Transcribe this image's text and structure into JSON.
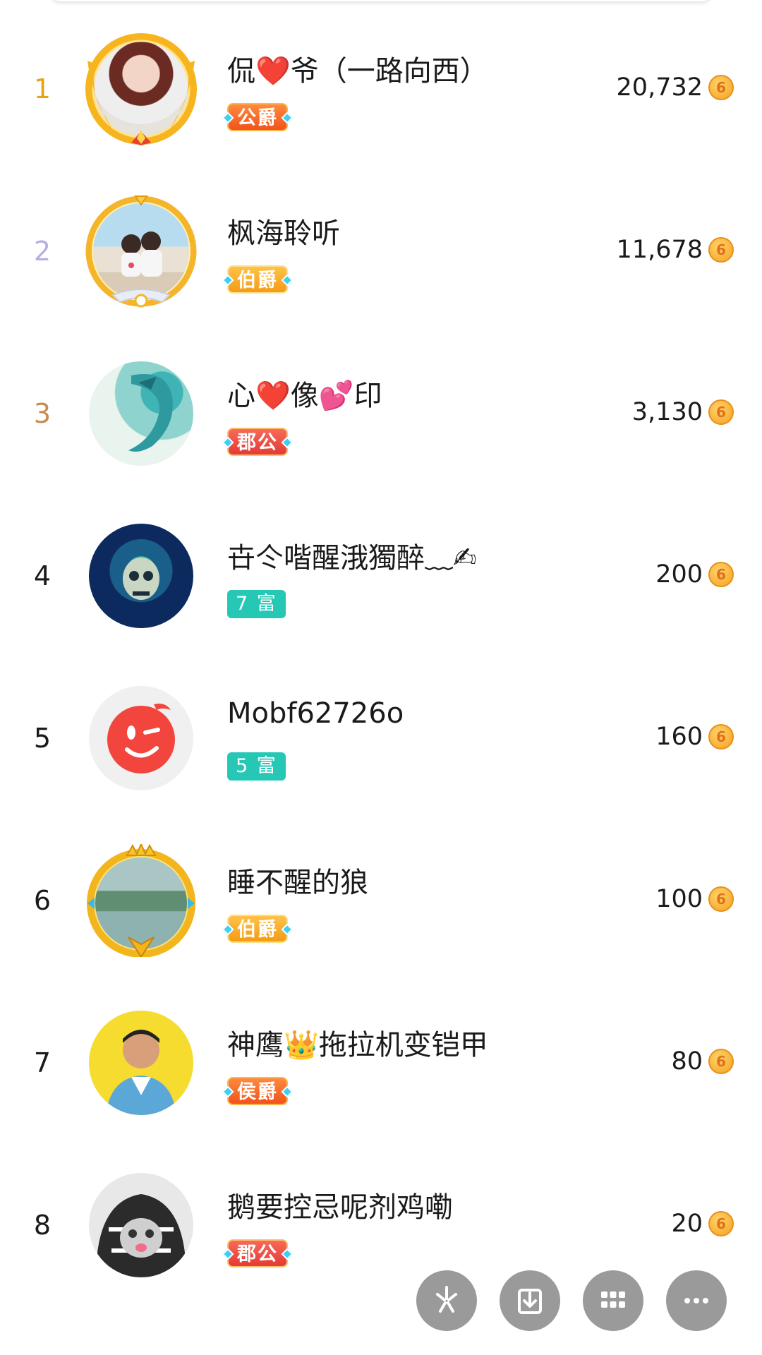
{
  "list": {
    "rows": [
      {
        "rank": "1",
        "name": "侃❤️爷（一路向西）",
        "badge": "公爵",
        "score": "20,732"
      },
      {
        "rank": "2",
        "name": "枫海聆听",
        "badge": "伯爵",
        "score": "11,678"
      },
      {
        "rank": "3",
        "name": "心❤️像💕印",
        "badge": "郡公",
        "score": "3,130"
      },
      {
        "rank": "4",
        "name": "卋仒喈醒涐獨醉﹏✍",
        "badge": "7 富",
        "score": "200"
      },
      {
        "rank": "5",
        "name": "Mobf62726o",
        "badge": "5 富",
        "score": "160"
      },
      {
        "rank": "6",
        "name": "睡不醒的狼",
        "badge": "伯爵",
        "score": "100"
      },
      {
        "rank": "7",
        "name": "神鹰👑拖拉机变铠甲",
        "badge": "侯爵",
        "score": "80"
      },
      {
        "rank": "8",
        "name": "鹅要控忌呢剂鸡嘞",
        "badge": "郡公",
        "score": "20"
      }
    ],
    "coin_glyph": "6"
  },
  "colors": {
    "rank1": "#e8a21a",
    "rank2": "#b7aee6",
    "rank3": "#c98a4b",
    "rank_default": "#1a1a1a",
    "rich_badge": "#27c7b5",
    "fab_bg": "#9a9a9a"
  },
  "fab": {
    "icons": [
      "sparkle-icon",
      "download-icon",
      "grid-icon",
      "more-icon"
    ]
  }
}
